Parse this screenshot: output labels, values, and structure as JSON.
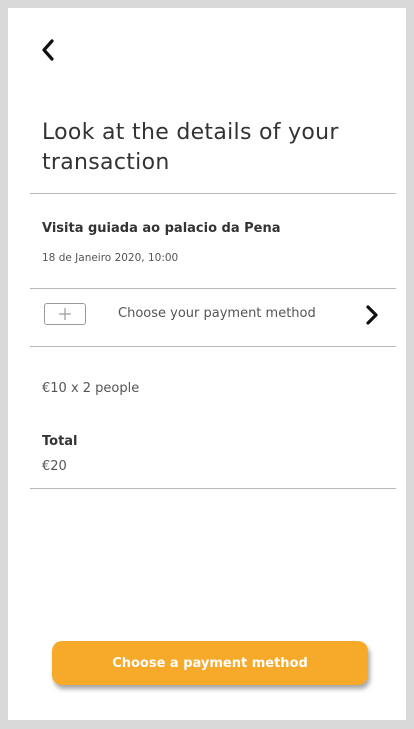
{
  "header": {
    "back_icon": "chevron-left-icon",
    "title": "Look at the details of your transaction"
  },
  "booking": {
    "tour_name": "Visita guiada ao palacio da Pena",
    "date": "18 de Janeiro 2020, 10:00"
  },
  "payment": {
    "add_icon": "plus-icon",
    "label": "Choose your payment method",
    "chevron_icon": "chevron-right-icon"
  },
  "pricing": {
    "price_line": "€10 x 2 people",
    "total_label": "Total",
    "total_value": "€20"
  },
  "cta": {
    "label": "Choose a payment method"
  },
  "colors": {
    "accent": "#f7a92a",
    "text_dark": "#333333",
    "text_muted": "#555555",
    "divider": "#b8b8b8",
    "frame": "#d9d9d9"
  }
}
